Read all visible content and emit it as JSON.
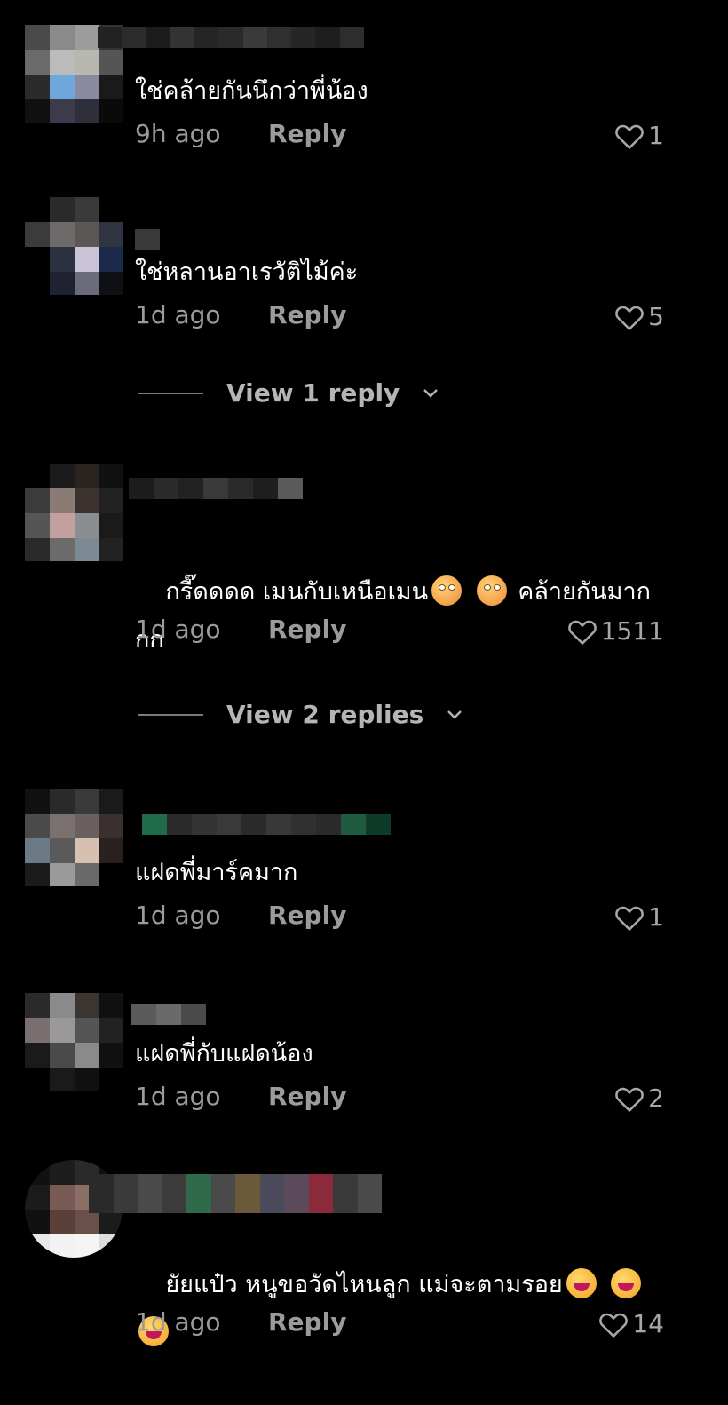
{
  "comments": [
    {
      "text": "ใช่คล้ายกันนึกว่าพี่น้อง",
      "time": "9h ago",
      "reply_label": "Reply",
      "likes": "1"
    },
    {
      "text": "ใช่หลานอาเรวัติไม้ค่ะ",
      "time": "1d ago",
      "reply_label": "Reply",
      "likes": "5",
      "view_replies": "View 1 reply"
    },
    {
      "text_line1": "กรี๊ดดดด เมนกับเหนือเมน",
      "text_after_emoji": "คล้ายกันมาก",
      "text_line2": "กก",
      "time": "1d ago",
      "reply_label": "Reply",
      "likes": "1511",
      "view_replies": "View 2 replies"
    },
    {
      "text": "แฝดพี่มาร์คมาก",
      "time": "1d ago",
      "reply_label": "Reply",
      "likes": "1"
    },
    {
      "text": "แฝดพี่กับแฝดน้อง",
      "time": "1d ago",
      "reply_label": "Reply",
      "likes": "2"
    },
    {
      "text_line1": "ยัยแป๋ว หนูขอวัดไหนลูก แม่จะตามรอย",
      "time": "1d ago",
      "reply_label": "Reply",
      "likes": "14"
    }
  ],
  "icons": {
    "like": "heart-outline-icon",
    "expand": "chevron-down-icon",
    "emoji_flushed": "flushed-face-icon",
    "emoji_grin": "grinning-squint-tongue-icon"
  },
  "colors": {
    "background": "#000000",
    "meta_text": "#9b9b9b",
    "body_text": "#ffffff"
  }
}
